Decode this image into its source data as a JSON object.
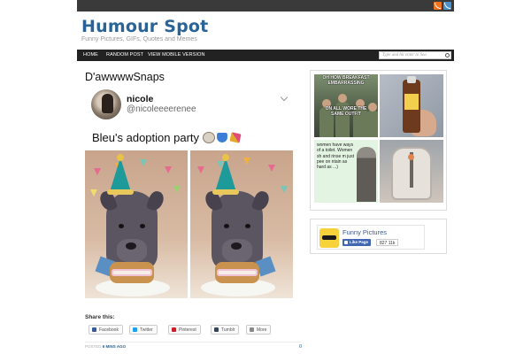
{
  "site": {
    "title": "Humour Spot",
    "tagline": "Funny Pictures, GIFs, Quotes and Memes"
  },
  "topbar": {
    "icons": [
      "rss-icon",
      "feed-icon"
    ],
    "colors": {
      "rss": "#f2711c",
      "feed": "#4a90c9"
    }
  },
  "nav": {
    "items": [
      {
        "label": "HOME"
      },
      {
        "label": "RANDOM POST"
      },
      {
        "label": "VIEW MOBILE VERSION"
      }
    ],
    "search_placeholder": "Type and hit enter to Sea"
  },
  "post": {
    "title": "D'awwwwSnaps",
    "tweet": {
      "name": "nicole",
      "handle": "@nicoleeeerenee",
      "text": "Bleu's adoption party",
      "emojis": [
        "dog-face-emoji",
        "blue-heart-emoji",
        "party-popper-emoji"
      ]
    },
    "share": {
      "label": "Share this:",
      "buttons": [
        {
          "label": "Facebook",
          "icon": "facebook-icon",
          "color": "#3b5998"
        },
        {
          "label": "Twitter",
          "icon": "twitter-icon",
          "color": "#1da1f2"
        },
        {
          "label": "Pinterest",
          "icon": "pinterest-icon",
          "color": "#cb2027"
        },
        {
          "label": "Tumblr",
          "icon": "tumblr-icon",
          "color": "#35465c"
        },
        {
          "label": "More",
          "icon": "more-icon",
          "color": "#888888"
        }
      ]
    },
    "meta": {
      "prefix": "POSTED",
      "ago": "6 MINS AGO",
      "comments": "0"
    }
  },
  "sidebar": {
    "thumbs": {
      "t1_top": "OH HOW BREAKFAST EMBARRASSING",
      "t1_bottom": "ON ALL WORE THE SAME OUTFIT",
      "t3_text": "women have ways of a toilet. Women sh and rinse m just pee on ntain as hard as ...)"
    },
    "facebook": {
      "page_name": "Funny Pictures",
      "like_label": "Like Page",
      "like_count": "827 11k"
    }
  }
}
